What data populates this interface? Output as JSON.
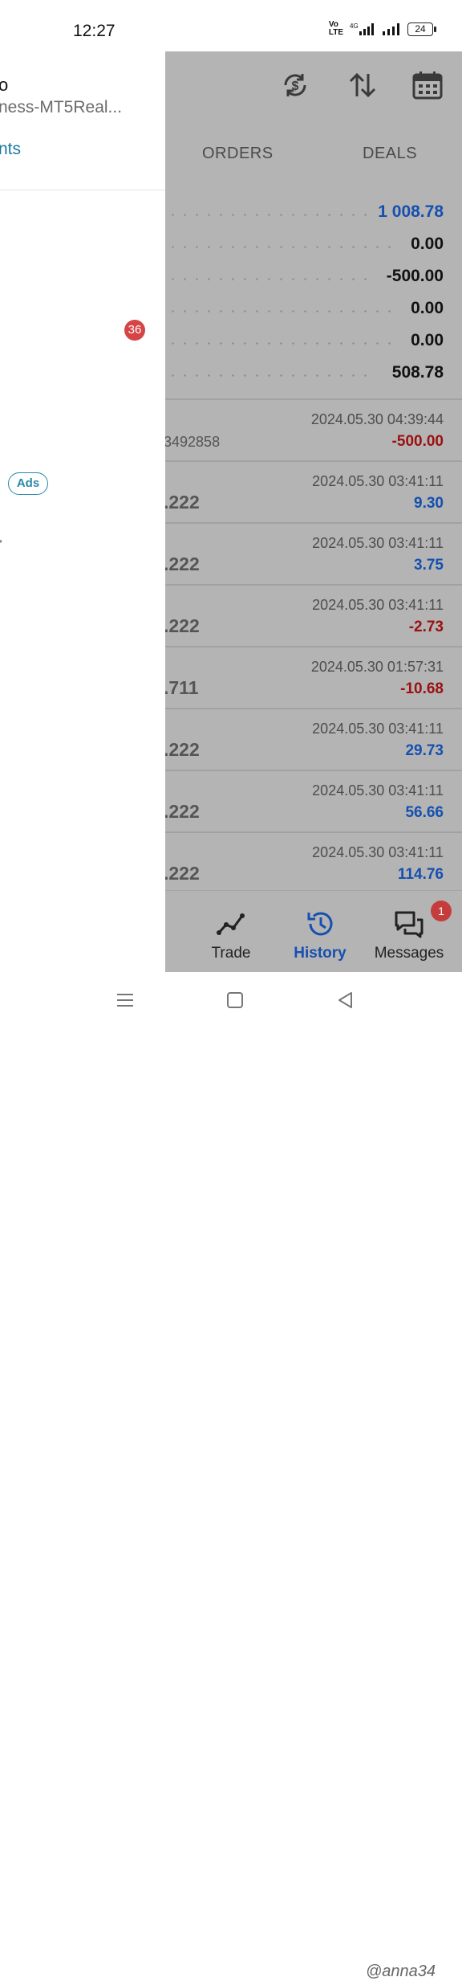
{
  "status_bar": {
    "time": "12:27",
    "network_label": "VoLTE 4G",
    "battery": "24"
  },
  "drawer": {
    "account_name": "o",
    "server": "ness-MT5Real...",
    "accounts_link": "nts",
    "badge_count": "36",
    "ads_label": "Ads"
  },
  "toolbar": {
    "icons": [
      "currency-exchange-icon",
      "sort-icon",
      "calendar-icon"
    ]
  },
  "tabs": [
    "ORDERS",
    "DEALS"
  ],
  "summary": [
    {
      "value": "1 008.78",
      "color": "blue"
    },
    {
      "value": "0.00",
      "color": "black"
    },
    {
      "value": "-500.00",
      "color": "black"
    },
    {
      "value": "0.00",
      "color": "black"
    },
    {
      "value": "0.00",
      "color": "black"
    },
    {
      "value": "508.78",
      "color": "black"
    }
  ],
  "deals": [
    {
      "left": "3492858",
      "date": "2024.05.30 04:39:44",
      "amount": "-500.00",
      "sign": "neg"
    },
    {
      "left": ".222",
      "date": "2024.05.30 03:41:11",
      "amount": "9.30",
      "sign": "pos"
    },
    {
      "left": ".222",
      "date": "2024.05.30 03:41:11",
      "amount": "3.75",
      "sign": "pos"
    },
    {
      "left": ".222",
      "date": "2024.05.30 03:41:11",
      "amount": "-2.73",
      "sign": "neg"
    },
    {
      "left": ".711",
      "date": "2024.05.30 01:57:31",
      "amount": "-10.68",
      "sign": "neg"
    },
    {
      "left": ".222",
      "date": "2024.05.30 03:41:11",
      "amount": "29.73",
      "sign": "pos"
    },
    {
      "left": ".222",
      "date": "2024.05.30 03:41:11",
      "amount": "56.66",
      "sign": "pos"
    },
    {
      "left": ".222",
      "date": "2024.05.30 03:41:11",
      "amount": "114.76",
      "sign": "pos"
    }
  ],
  "bottom_nav": {
    "trade": "Trade",
    "history": "History",
    "messages": "Messages",
    "messages_badge": "1"
  },
  "watermark": "@anna34",
  "colors": {
    "accent_blue": "#1550b0",
    "negative_red": "#9b1010",
    "overlay_gray": "#b4b4b4",
    "badge_red": "#d64545",
    "link_teal": "#1a7aa3"
  }
}
